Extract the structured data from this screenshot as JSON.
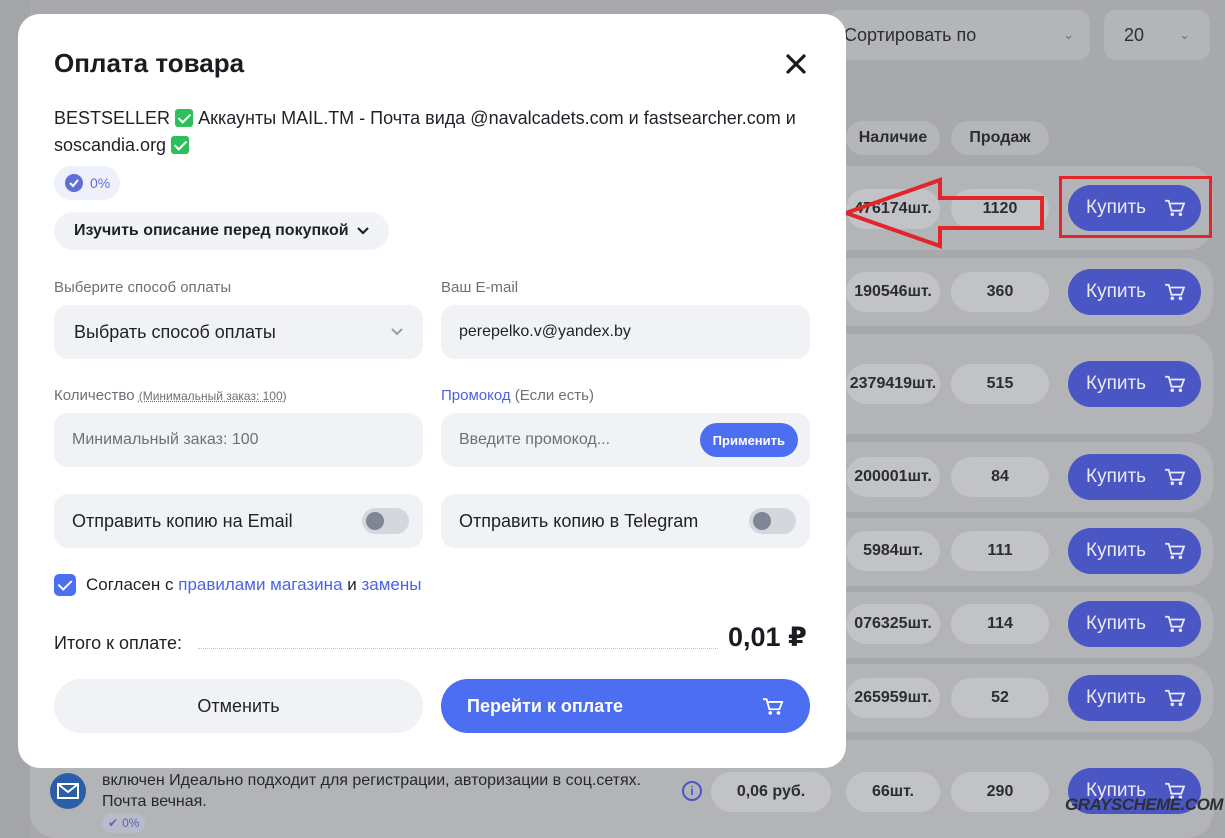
{
  "background": {
    "sort_label": "Сортировать по",
    "per_page": "20",
    "columns": [
      "Наличие",
      "Продаж"
    ],
    "rows": [
      {
        "stock": "476174шт.",
        "sales": "1120",
        "buy": "Купить"
      },
      {
        "stock": "190546шт.",
        "sales": "360",
        "buy": "Купить"
      },
      {
        "stock": "2379419шт.",
        "sales": "515",
        "buy": "Купить"
      },
      {
        "stock": "200001шт.",
        "sales": "84",
        "buy": "Купить"
      },
      {
        "stock": "5984шт.",
        "sales": "111",
        "buy": "Купить"
      },
      {
        "stock": "076325шт.",
        "sales": "114",
        "buy": "Купить"
      },
      {
        "stock": "265959шт.",
        "sales": "52",
        "buy": "Купить"
      },
      {
        "price": "0,06 руб.",
        "stock": "66шт.",
        "sales": "290",
        "buy": "Купить"
      }
    ],
    "bottom_text_line1": "включен Идеально подходит для регистрации, авторизации в соц.сетях.",
    "bottom_text_line2": "Почта вечная.",
    "bottom_badge": "0%",
    "watermark": "GRAYSCHEME.COM"
  },
  "modal": {
    "title": "Оплата товара",
    "product_part1": "BESTSELLER",
    "product_part2": "Аккаунты MAIL.TM - Почта вида @navalcadets.com и fastsearcher.com и",
    "product_part3": "soscandia.org",
    "discount": "0%",
    "description_button": "Изучить описание перед покупкой",
    "payment_label": "Выберите способ оплаты",
    "payment_value": "Выбрать способ оплаты",
    "email_label": "Ваш E-mail",
    "email_value": "perepelko.v@yandex.by",
    "quantity_label": "Количество",
    "quantity_hint": "(Минимальный заказ: 100)",
    "quantity_placeholder": "Минимальный заказ: 100",
    "promo_label_link": "Промокод",
    "promo_label_rest": "(Если есть)",
    "promo_placeholder": "Введите промокод...",
    "apply_button": "Применить",
    "copy_email_label": "Отправить копию на Email",
    "copy_telegram_label": "Отправить копию в Telegram",
    "agree_text": "Согласен с",
    "agree_link1": "правилами магазина",
    "agree_and": "и",
    "agree_link2": "замены",
    "total_label": "Итого к оплате:",
    "total_value": "0,01 ₽",
    "cancel_button": "Отменить",
    "pay_button": "Перейти к оплате"
  },
  "colors": {
    "accent": "#4c6ef0",
    "highlight": "#e2242b",
    "overlay": "#a6a7ab"
  }
}
